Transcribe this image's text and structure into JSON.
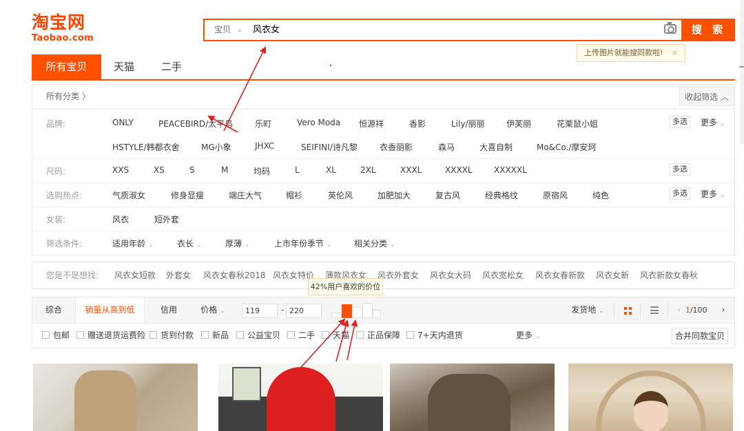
{
  "logo": {
    "main": "淘宝网",
    "sub": "Taobao.com"
  },
  "search": {
    "type_label": "宝贝",
    "query": "风衣女",
    "button_label": "搜 索",
    "image_tip": "上传图片就能搜同款啦!",
    "tip_close": "×"
  },
  "main_tabs": [
    "所有宝贝",
    "天猫",
    "二手"
  ],
  "category": {
    "all_label": "所有分类 〉",
    "collapse_label": "收起筛选 ︿"
  },
  "filters": {
    "brand_label": "品牌:",
    "brands_row1": [
      "ONLY",
      "PEACEBIRD/太平鸟",
      "乐町",
      "Vero Moda",
      "恒源祥",
      "香影",
      "Lily/丽丽",
      "伊芙丽",
      "花栗鼠小姐"
    ],
    "brands_row2": [
      "HSTYLE/韩都衣舍",
      "MG小象",
      "JHXC",
      "SEIFINI/诗凡黎",
      "衣香丽影",
      "森马",
      "大喜自制",
      "Mo&Co./摩安珂"
    ],
    "size_label": "尺码:",
    "sizes": [
      "XXS",
      "XS",
      "S",
      "M",
      "均码",
      "L",
      "XL",
      "2XL",
      "XXXL",
      "XXXXL",
      "XXXXXL"
    ],
    "hot_label": "选购热点:",
    "hot": [
      "气质淑女",
      "修身显瘦",
      "端庄大气",
      "帽衫",
      "英伦风",
      "加肥加大",
      "复古风",
      "经典格纹",
      "原宿风",
      "纯色"
    ],
    "women_label": "女装:",
    "women": [
      "风衣",
      "短外套"
    ],
    "cond_label": "筛选条件:",
    "conds": [
      "适用年龄",
      "衣长",
      "厚薄",
      "上市年份季节",
      "相关分类"
    ],
    "multi_label": "多选",
    "more_label": "更多"
  },
  "did_you_mean": {
    "label": "您是不是想找:",
    "items": [
      "风衣女短款",
      "外套女",
      "风衣女春秋2018",
      "风衣女特价",
      "薄款风衣女",
      "风衣外套女",
      "风衣女大码",
      "风衣宽松女",
      "风衣女春新款",
      "风衣女新",
      "风衣新款女春秋"
    ]
  },
  "sort": {
    "items": [
      "综合",
      "销量从高到低",
      "信用",
      "价格"
    ],
    "price_min": "119",
    "price_dash": "-",
    "price_max": "220",
    "price_tip": "42%用户喜欢的价位",
    "ship_from": "发货地",
    "page_current": "1",
    "page_total": "/100",
    "prev": "‹",
    "next": "›"
  },
  "options": {
    "items": [
      "包邮",
      "赠送退货运费险",
      "货到付款",
      "新品",
      "公益宝贝",
      "二手",
      "天猫",
      "正品保障",
      "7+天内退货"
    ],
    "more_label": "更多",
    "merge_label": "合并同款宝贝"
  },
  "colors": {
    "accent": "#ff5000",
    "tip_bg": "#fffbeb",
    "annotation": "#e02020"
  }
}
